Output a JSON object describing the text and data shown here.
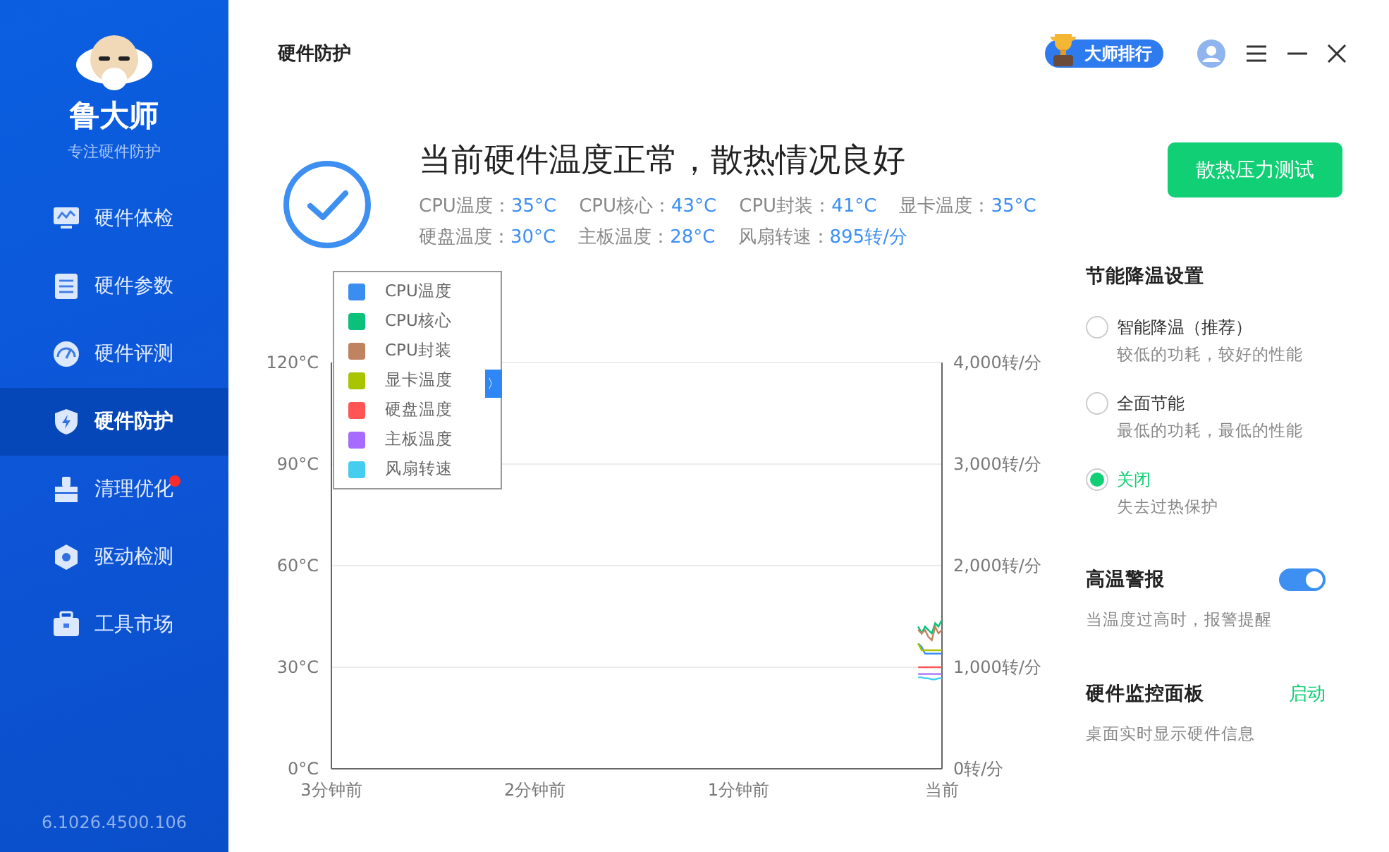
{
  "sidebar": {
    "brand": "鲁大师",
    "slogan": "专注硬件防护",
    "items": [
      {
        "label": "硬件体检",
        "selected": false,
        "badge": false
      },
      {
        "label": "硬件参数",
        "selected": false,
        "badge": false
      },
      {
        "label": "硬件评测",
        "selected": false,
        "badge": false
      },
      {
        "label": "硬件防护",
        "selected": true,
        "badge": false
      },
      {
        "label": "清理优化",
        "selected": false,
        "badge": true
      },
      {
        "label": "驱动检测",
        "selected": false,
        "badge": false
      },
      {
        "label": "工具市场",
        "selected": false,
        "badge": false
      }
    ],
    "version": "6.1026.4500.106"
  },
  "header": {
    "title": "硬件防护",
    "ranking_button": "大师排行"
  },
  "status": {
    "headline": "当前硬件温度正常，散热情况良好",
    "readings": [
      {
        "label": "CPU温度：",
        "value": "35°C"
      },
      {
        "label": "CPU核心：",
        "value": "43°C"
      },
      {
        "label": "CPU封装：",
        "value": "41°C"
      },
      {
        "label": "显卡温度：",
        "value": "35°C"
      },
      {
        "label": "硬盘温度：",
        "value": "30°C"
      },
      {
        "label": "主板温度：",
        "value": "28°C"
      },
      {
        "label": "风扇转速：",
        "value": "895转/分"
      }
    ],
    "action_button": "散热压力测试"
  },
  "chart": {
    "legend_toggle": "〉",
    "chart_data": {
      "type": "line",
      "grid": true,
      "legend": true,
      "x": [
        0.117,
        0.1,
        0.083,
        0.067,
        0.05,
        0.033,
        0.017,
        0
      ],
      "xlim": [
        3,
        0
      ],
      "xticks": [
        {
          "value": 3,
          "label": "3分钟前"
        },
        {
          "value": 2,
          "label": "2分钟前"
        },
        {
          "value": 1,
          "label": "1分钟前"
        },
        {
          "value": 0,
          "label": "当前"
        }
      ],
      "ylim": [
        0,
        120
      ],
      "yticks": [
        {
          "value": 0,
          "label": "0°C"
        },
        {
          "value": 30,
          "label": "30°C"
        },
        {
          "value": 60,
          "label": "60°C"
        },
        {
          "value": 90,
          "label": "90°C"
        },
        {
          "value": 120,
          "label": "120°C"
        }
      ],
      "y2lim": [
        0,
        4000
      ],
      "y2ticks": [
        {
          "value": 0,
          "label": "0转/分"
        },
        {
          "value": 1000,
          "label": "1,000转/分"
        },
        {
          "value": 2000,
          "label": "2,000转/分"
        },
        {
          "value": 3000,
          "label": "3,000转/分"
        },
        {
          "value": 4000,
          "label": "4,000转/分"
        }
      ],
      "series": [
        {
          "name": "CPU温度",
          "color": "#3a8ef0",
          "values": [
            37,
            36,
            34,
            34,
            34,
            34,
            34,
            34
          ]
        },
        {
          "name": "CPU核心",
          "color": "#0ac07a",
          "values": [
            42,
            40,
            42,
            41,
            40,
            43,
            42,
            44
          ]
        },
        {
          "name": "CPU封装",
          "color": "#c0835f",
          "values": [
            41,
            40,
            41,
            39,
            38,
            42,
            40,
            41
          ]
        },
        {
          "name": "显卡温度",
          "color": "#a8c400",
          "values": [
            37,
            35,
            35,
            35,
            35,
            35,
            35,
            35
          ]
        },
        {
          "name": "硬盘温度",
          "color": "#ff5555",
          "values": [
            30,
            30,
            30,
            30,
            30,
            30,
            30,
            30
          ]
        },
        {
          "name": "主板温度",
          "color": "#a66cff",
          "values": [
            28,
            28,
            28,
            28,
            28,
            28,
            28,
            28
          ]
        },
        {
          "name": "风扇转速",
          "color": "#45cdf0",
          "axis": "y2",
          "values": [
            900,
            900,
            890,
            890,
            880,
            880,
            890,
            890
          ]
        }
      ]
    }
  },
  "settings": {
    "title": "节能降温设置",
    "options": [
      {
        "label": "智能降温（推荐）",
        "description": "较低的功耗，较好的性能",
        "selected": false
      },
      {
        "label": "全面节能",
        "description": "最低的功耗，最低的性能",
        "selected": false
      },
      {
        "label": "关闭",
        "description": "失去过热保护",
        "selected": true
      }
    ],
    "alarm": {
      "label": "高温警报",
      "on": true,
      "description": "当温度过高时，报警提醒"
    },
    "monitor": {
      "label": "硬件监控面板",
      "action": "启动",
      "description": "桌面实时显示硬件信息"
    }
  }
}
